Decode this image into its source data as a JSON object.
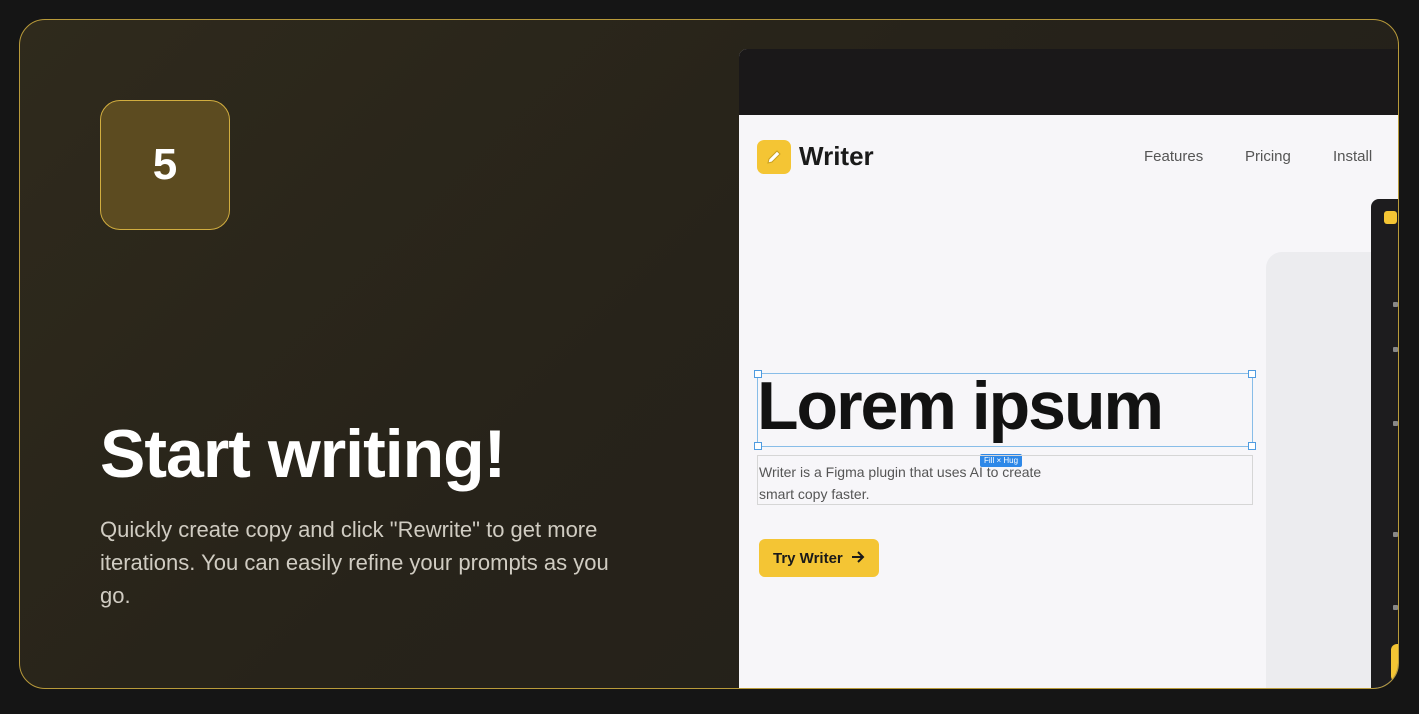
{
  "step": {
    "number": "5"
  },
  "heading": "Start writing!",
  "description": "Quickly create copy and click \"Rewrite\" to get more iterations. You can easily refine your prompts as you go.",
  "preview": {
    "brand": "Writer",
    "nav": [
      "Features",
      "Pricing",
      "Install"
    ],
    "headline": "Lorem ipsum",
    "tag": "Fill × Hug",
    "subtext": "Writer is a Figma plugin that uses AI to create smart copy faster.",
    "button_label": "Try Writer"
  },
  "colors": {
    "card_border": "#b89a3a",
    "badge_bg": "#5c4b20",
    "accent_yellow": "#f4c534",
    "selection_blue": "#4f9be0"
  },
  "icons": [
    "pencil-icon",
    "arrow-right-icon"
  ]
}
